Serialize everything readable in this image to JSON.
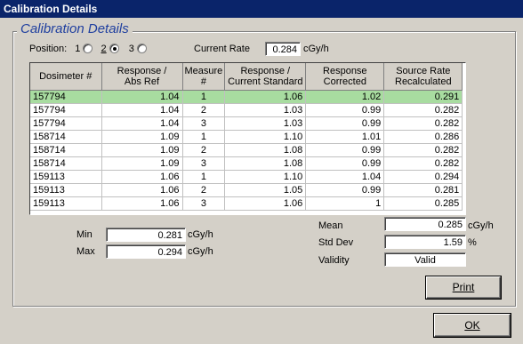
{
  "window": {
    "title": "Calibration Details"
  },
  "group": {
    "title": "Calibration Details"
  },
  "position": {
    "label": "Position:",
    "options": [
      "1",
      "2",
      "3"
    ],
    "selected": "2"
  },
  "current_rate": {
    "label": "Current Rate",
    "value": "0.284",
    "unit": "cGy/h"
  },
  "table": {
    "headers": [
      [
        "Dosimeter #",
        ""
      ],
      [
        "Response /",
        "Abs Ref"
      ],
      [
        "Measure",
        "#"
      ],
      [
        "Response /",
        "Current Standard"
      ],
      [
        "Response",
        "Corrected"
      ],
      [
        "Source Rate",
        "Recalculated"
      ]
    ],
    "rows": [
      [
        "157794",
        "1.04",
        "1",
        "1.06",
        "1.02",
        "0.291"
      ],
      [
        "157794",
        "1.04",
        "2",
        "1.03",
        "0.99",
        "0.282"
      ],
      [
        "157794",
        "1.04",
        "3",
        "1.03",
        "0.99",
        "0.282"
      ],
      [
        "158714",
        "1.09",
        "1",
        "1.10",
        "1.01",
        "0.286"
      ],
      [
        "158714",
        "1.09",
        "2",
        "1.08",
        "0.99",
        "0.282"
      ],
      [
        "158714",
        "1.09",
        "3",
        "1.08",
        "0.99",
        "0.282"
      ],
      [
        "159113",
        "1.06",
        "1",
        "1.10",
        "1.04",
        "0.294"
      ],
      [
        "159113",
        "1.06",
        "2",
        "1.05",
        "0.99",
        "0.281"
      ],
      [
        "159113",
        "1.06",
        "3",
        "1.06",
        "1",
        "0.285"
      ]
    ],
    "selected_row": 0
  },
  "stats": {
    "min_label": "Min",
    "min_value": "0.281",
    "min_unit": "cGy/h",
    "max_label": "Max",
    "max_value": "0.294",
    "max_unit": "cGy/h",
    "mean_label": "Mean",
    "mean_value": "0.285",
    "mean_unit": "cGy/h",
    "std_label": "Std Dev",
    "std_value": "1.59",
    "std_unit": "%",
    "validity_label": "Validity",
    "validity_value": "Valid"
  },
  "buttons": {
    "print": "Print",
    "ok": "OK"
  },
  "colors": {
    "titlebar": "#0a246a",
    "group_title": "#1f3f9f",
    "selected_row": "#a8dca0"
  }
}
